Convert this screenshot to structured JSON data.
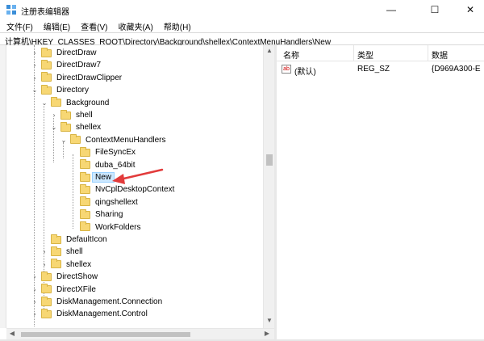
{
  "window": {
    "title": "注册表编辑器",
    "min_glyph": "—",
    "max_glyph": "☐",
    "close_glyph": "✕"
  },
  "menu": [
    "文件(F)",
    "编辑(E)",
    "查看(V)",
    "收藏夹(A)",
    "帮助(H)"
  ],
  "address": "计算机\\HKEY_CLASSES_ROOT\\Directory\\Background\\shellex\\ContextMenuHandlers\\New",
  "tree": [
    {
      "label": "DirectDraw",
      "expander": "›",
      "level": 0
    },
    {
      "label": "DirectDraw7",
      "expander": "›",
      "level": 0
    },
    {
      "label": "DirectDrawClipper",
      "expander": "›",
      "level": 0
    },
    {
      "label": "Directory",
      "expander": "⌄",
      "level": 0
    },
    {
      "label": "Background",
      "expander": "⌄",
      "level": 1
    },
    {
      "label": "shell",
      "expander": "›",
      "level": 2
    },
    {
      "label": "shellex",
      "expander": "⌄",
      "level": 2
    },
    {
      "label": "ContextMenuHandlers",
      "expander": "⌄",
      "level": 3
    },
    {
      "label": "FileSyncEx",
      "expander": "",
      "level": 4
    },
    {
      "label": "duba_64bit",
      "expander": "",
      "level": 4
    },
    {
      "label": "New",
      "expander": "",
      "level": 4,
      "selected": true
    },
    {
      "label": "NvCplDesktopContext",
      "expander": "",
      "level": 4
    },
    {
      "label": "qingshellext",
      "expander": "",
      "level": 4
    },
    {
      "label": "Sharing",
      "expander": "",
      "level": 4
    },
    {
      "label": "WorkFolders",
      "expander": "",
      "level": 4
    },
    {
      "label": "DefaultIcon",
      "expander": "",
      "level": 1
    },
    {
      "label": "shell",
      "expander": "›",
      "level": 1
    },
    {
      "label": "shellex",
      "expander": "›",
      "level": 1
    },
    {
      "label": "DirectShow",
      "expander": "›",
      "level": 0
    },
    {
      "label": "DirectXFile",
      "expander": "›",
      "level": 0
    },
    {
      "label": "DiskManagement.Connection",
      "expander": "›",
      "level": 0
    },
    {
      "label": "DiskManagement.Control",
      "expander": "›",
      "level": 0
    }
  ],
  "scroll": {
    "up_glyph": "▲",
    "down_glyph": "▼",
    "left_glyph": "◀",
    "right_glyph": "▶"
  },
  "values_pane": {
    "headers": {
      "name": "名称",
      "type": "类型",
      "data": "数据"
    },
    "rows": [
      {
        "icon_text": "ab",
        "name": "(默认)",
        "type": "REG_SZ",
        "data": "{D969A300-E"
      }
    ]
  },
  "colors": {
    "selection": "#cce8ff",
    "annotation_arrow": "#e23b3b",
    "folder": "#f7d774"
  }
}
